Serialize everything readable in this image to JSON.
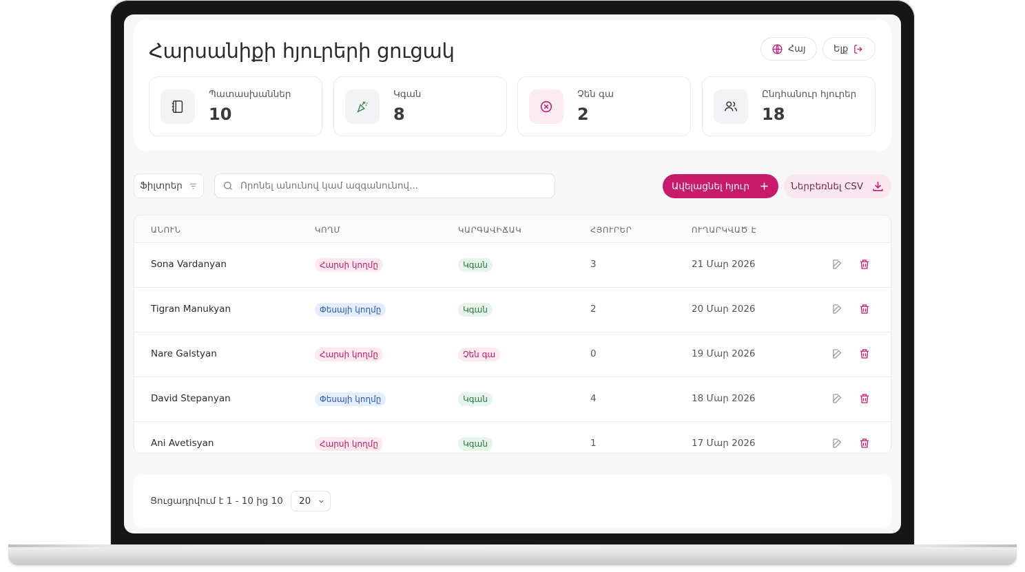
{
  "header": {
    "title": "Հարսանիքի հյուրերի ցուցակ",
    "language_label": "Հայ",
    "logout_label": "Ելք"
  },
  "stats": [
    {
      "label": "Պատասխաններ",
      "value": "10",
      "icon": "notebook-icon"
    },
    {
      "label": "Կգան",
      "value": "8",
      "icon": "party-popper-icon"
    },
    {
      "label": "Չեն գա",
      "value": "2",
      "icon": "x-circle-icon"
    },
    {
      "label": "Ընդհանուր հյուրեր",
      "value": "18",
      "icon": "users-icon"
    }
  ],
  "toolbar": {
    "filters_label": "Ֆիլտրեր",
    "search_placeholder": "Որոնել անունով կամ ազգանունով...",
    "add_guest_label": "Ավելացնել հյուր",
    "export_csv_label": "Ներբեռնել CSV"
  },
  "table": {
    "columns": [
      "ԱՆՈՒՆ",
      "ԿՈՂՄ",
      "ԿԱՐԳԱՎԻՃԱԿ",
      "ՀՅՈՒՐԵՐ",
      "ՈՒՂԱՐԿՎԱԾ Է"
    ],
    "rows": [
      {
        "name": "Sona Vardanyan",
        "side": "Հարսի կողմը",
        "side_type": "bride",
        "status": "Կգան",
        "status_type": "yes",
        "guests": "3",
        "sent": "21 Մար 2026"
      },
      {
        "name": "Tigran Manukyan",
        "side": "Փեսայի կողմը",
        "side_type": "groom",
        "status": "Կգան",
        "status_type": "yes",
        "guests": "2",
        "sent": "20 Մար 2026"
      },
      {
        "name": "Nare Galstyan",
        "side": "Հարսի կողմը",
        "side_type": "bride",
        "status": "Չեն գա",
        "status_type": "no",
        "guests": "0",
        "sent": "19 Մար 2026"
      },
      {
        "name": "David Stepanyan",
        "side": "Փեսայի կողմը",
        "side_type": "groom",
        "status": "Կգան",
        "status_type": "yes",
        "guests": "4",
        "sent": "18 Մար 2026"
      },
      {
        "name": "Ani Avetisyan",
        "side": "Հարսի կողմը",
        "side_type": "bride",
        "status": "Կգան",
        "status_type": "yes",
        "guests": "1",
        "sent": "17 Մար 2026"
      }
    ]
  },
  "pagination": {
    "summary": "Ցուցադրվում է 1 - 10 ից 10",
    "page_size": "20"
  },
  "colors": {
    "accent": "#c9196b",
    "accent_soft": "#fbe7ef",
    "groom_badge": "#2a5ab8",
    "yes_badge": "#237a43"
  }
}
